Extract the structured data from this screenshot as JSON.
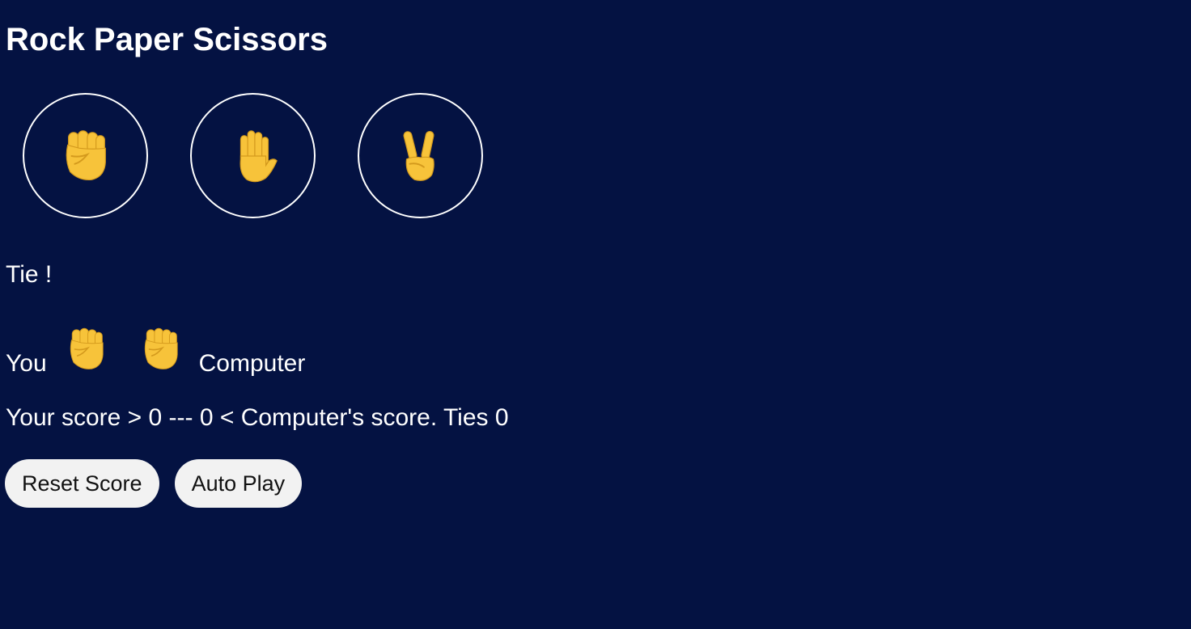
{
  "colors": {
    "background": "#041242",
    "text": "#ffffff",
    "button_bg": "#f2f2f2",
    "emoji": "#f7c33a"
  },
  "game": {
    "title": "Rock Paper Scissors"
  },
  "moves": [
    {
      "name": "rock",
      "icon": "raised-fist-icon"
    },
    {
      "name": "paper",
      "icon": "raised-hand-icon"
    },
    {
      "name": "scissors",
      "icon": "victory-hand-icon"
    }
  ],
  "result": {
    "text": "Tie !"
  },
  "picks": {
    "you_label": "You",
    "you_icon": "raised-fist-icon",
    "computer_icon": "raised-fist-icon",
    "computer_label": "Computer"
  },
  "score": {
    "text": "Your score > 0 --- 0 < Computer's score. Ties 0"
  },
  "actions": {
    "reset_label": "Reset Score",
    "autoplay_label": "Auto Play"
  }
}
